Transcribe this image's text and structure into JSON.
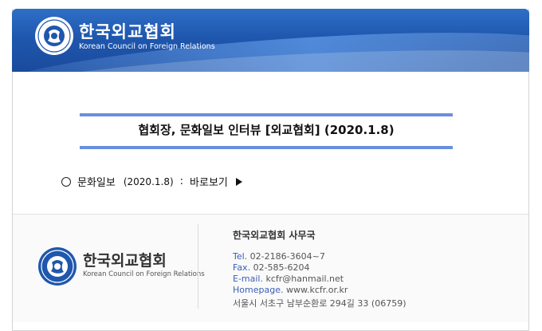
{
  "header": {
    "org_name": "한국외교협회",
    "org_name_en": "Korean Council on Foreign Relations"
  },
  "main": {
    "title": "협회장, 문화일보 인터뷰 [외교협회] (2020.1.8)",
    "link": {
      "source": "문화일보",
      "date": "(2020.1.8)",
      "separator": ":",
      "action": "바로보기"
    }
  },
  "footer": {
    "org_name": "한국외교협회",
    "org_name_en": "Korean Council on Foreign Relations",
    "office": "한국외교협회 사무국",
    "tel_label": "Tel.",
    "tel": "02-2186-3604~7",
    "fax_label": "Fax.",
    "fax": "02-585-6204",
    "email_label": "E-mail.",
    "email": "kcfr@hanmail.net",
    "homepage_label": "Homepage.",
    "homepage": "www.kcfr.or.kr",
    "address": "서울시 서초구 남부순환로 294길 33 (06759)"
  },
  "colors": {
    "header_blue": "#1f57ae",
    "accent_bar": "#6a8fe0",
    "label_blue": "#3a5fb5"
  }
}
